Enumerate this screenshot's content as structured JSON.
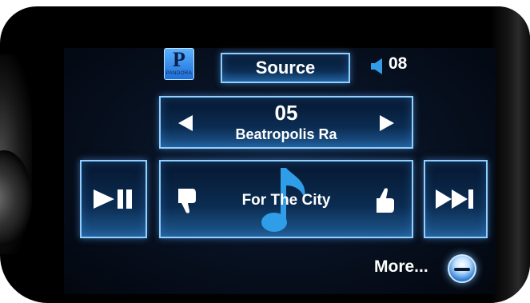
{
  "header": {
    "logo_letter": "P",
    "logo_sub": "PANDORA",
    "source_label": "Source",
    "volume_value": "08",
    "volume_icon": "speaker-icon"
  },
  "station": {
    "number": "05",
    "name": "Beatropolis Ra",
    "prev_icon": "arrow-left-icon",
    "next_icon": "arrow-right-icon"
  },
  "playback": {
    "play_pause_icon": "play-pause-icon",
    "song_title": "For The City",
    "thumbs_down_icon": "thumbs-down-icon",
    "thumbs_up_icon": "thumbs-up-icon",
    "music_note_icon": "music-note-icon",
    "skip_icon": "skip-forward-icon"
  },
  "footer": {
    "more_label": "More...",
    "more_icon": "minus-circle-icon"
  },
  "colors": {
    "accent": "#8fd0ff",
    "note": "#2f9de8",
    "background": "#07101f"
  }
}
